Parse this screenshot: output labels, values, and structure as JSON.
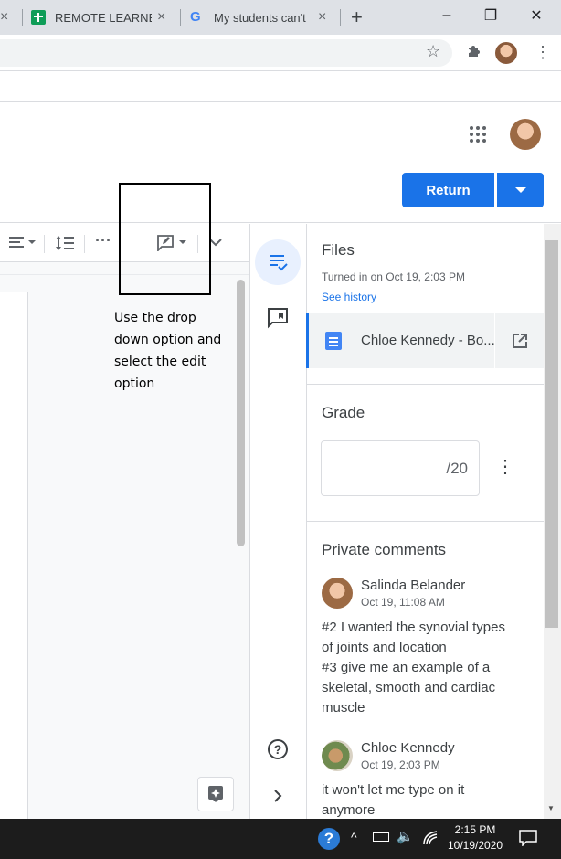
{
  "browser": {
    "tabs": [
      {
        "title": "REMOTE LEARNER"
      },
      {
        "title": "My students can't"
      }
    ],
    "tab_close_glyph": "×",
    "new_tab_glyph": "+",
    "window_controls": [
      "–",
      "❐",
      "✕"
    ]
  },
  "header": {
    "return_label": "Return"
  },
  "annotation": {
    "text": "Use the drop down option and select the edit option"
  },
  "files": {
    "title": "Files",
    "turned_in": "Turned in on Oct 19, 2:03 PM",
    "see_history": "See history",
    "file_name": "Chloe Kennedy - Bo..."
  },
  "grade": {
    "title": "Grade",
    "value": "/20"
  },
  "comments": {
    "title": "Private comments",
    "items": [
      {
        "author": "Salinda Belander",
        "time": "Oct 19, 11:08 AM",
        "text": "#2 I wanted the synovial types\nof joints and location\n#3 give me an example of a\nskeletal, smooth and cardiac\nmuscle"
      },
      {
        "author": "Chloe Kennedy",
        "time": "Oct 19, 2:03 PM",
        "text": "it won't let me type on it\nanymore"
      }
    ]
  },
  "taskbar": {
    "time": "2:15 PM",
    "date": "10/19/2020"
  },
  "icons": {
    "toolbar": [
      "align-icon",
      "line-spacing-icon",
      "more-icon",
      "edit-mode-icon",
      "collapse-icon"
    ],
    "rail": [
      "grading-icon",
      "comment-icon",
      "help-icon",
      "expand-icon"
    ]
  },
  "colors": {
    "accent": "#1a73e8",
    "taskbar": "#1c1c1c"
  }
}
